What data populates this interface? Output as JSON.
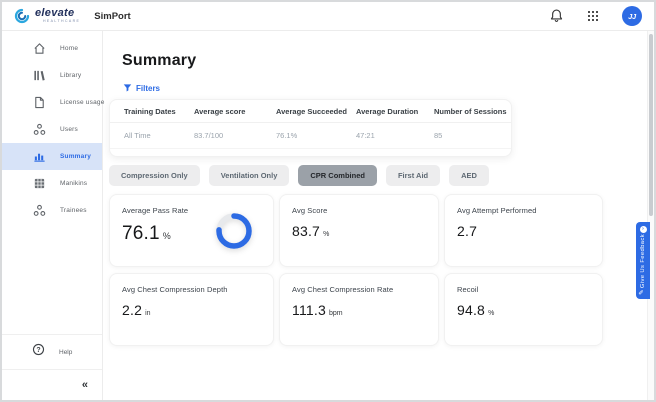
{
  "topbar": {
    "brand": "elevate",
    "brand_sub": "HEALTHCARE",
    "product": "SimPort",
    "avatar": "JJ"
  },
  "sidebar": {
    "items": [
      {
        "label": "Home"
      },
      {
        "label": "Library"
      },
      {
        "label": "License usage"
      },
      {
        "label": "Users"
      },
      {
        "label": "Summary",
        "active": true
      },
      {
        "label": "Manikins"
      },
      {
        "label": "Trainees"
      }
    ],
    "help_label": "Help",
    "collapse_glyph": "«"
  },
  "page": {
    "title": "Summary",
    "filters_label": "Filters"
  },
  "table": {
    "headers": [
      "Training Dates",
      "Average score",
      "Average Succeeded",
      "Average Duration",
      "Number of Sessions"
    ],
    "rows": [
      [
        "All Time",
        "83.7/100",
        "76.1%",
        "47:21",
        "85"
      ]
    ]
  },
  "tabs": [
    {
      "label": "Compression Only",
      "active": false
    },
    {
      "label": "Ventilation Only",
      "active": false
    },
    {
      "label": "CPR Combined",
      "active": true
    },
    {
      "label": "First Aid",
      "active": false
    },
    {
      "label": "AED",
      "active": false
    }
  ],
  "cards": [
    {
      "label": "Average Pass Rate",
      "value": "76.1",
      "unit": "%",
      "donut_percent": 76.1
    },
    {
      "label": "Avg Score",
      "value": "83.7",
      "unit": "%"
    },
    {
      "label": "Avg Attempt Performed",
      "value": "2.7",
      "unit": ""
    },
    {
      "label": "Avg Chest Compression Depth",
      "value": "2.2",
      "unit": "in"
    },
    {
      "label": "Avg Chest Compression Rate",
      "value": "111.3",
      "unit": "bpm"
    },
    {
      "label": "Recoil",
      "value": "94.8",
      "unit": "%"
    }
  ],
  "feedback": {
    "label": "Give Us Feedback"
  },
  "colors": {
    "accent": "#2D6BE4",
    "donut_track": "#E7E9EC",
    "sidebar_active_bg": "#D7E3F8",
    "tab_active_bg": "#9BA1A8"
  }
}
